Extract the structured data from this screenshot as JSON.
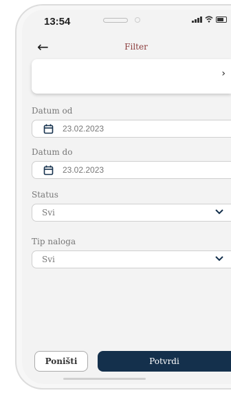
{
  "status_bar": {
    "time": "13:54"
  },
  "header": {
    "back_icon": "arrow-left-icon",
    "title": "Filter"
  },
  "card": {
    "chevron_icon": "chevron-right-icon"
  },
  "date_from": {
    "label": "Datum od",
    "value": "23.02.2023",
    "icon": "calendar-icon"
  },
  "date_to": {
    "label": "Datum do",
    "value": "23.02.2023",
    "icon": "calendar-icon"
  },
  "status": {
    "label": "Status",
    "value": "Svi",
    "icon": "chevron-down-icon"
  },
  "order_type": {
    "label": "Tip naloga",
    "value": "Svi",
    "icon": "chevron-down-icon"
  },
  "buttons": {
    "cancel": "Poništi",
    "confirm": "Potvrdi"
  },
  "colors": {
    "primary": "#14304c",
    "title": "#8a3a3a",
    "background": "#f3f3f3"
  }
}
